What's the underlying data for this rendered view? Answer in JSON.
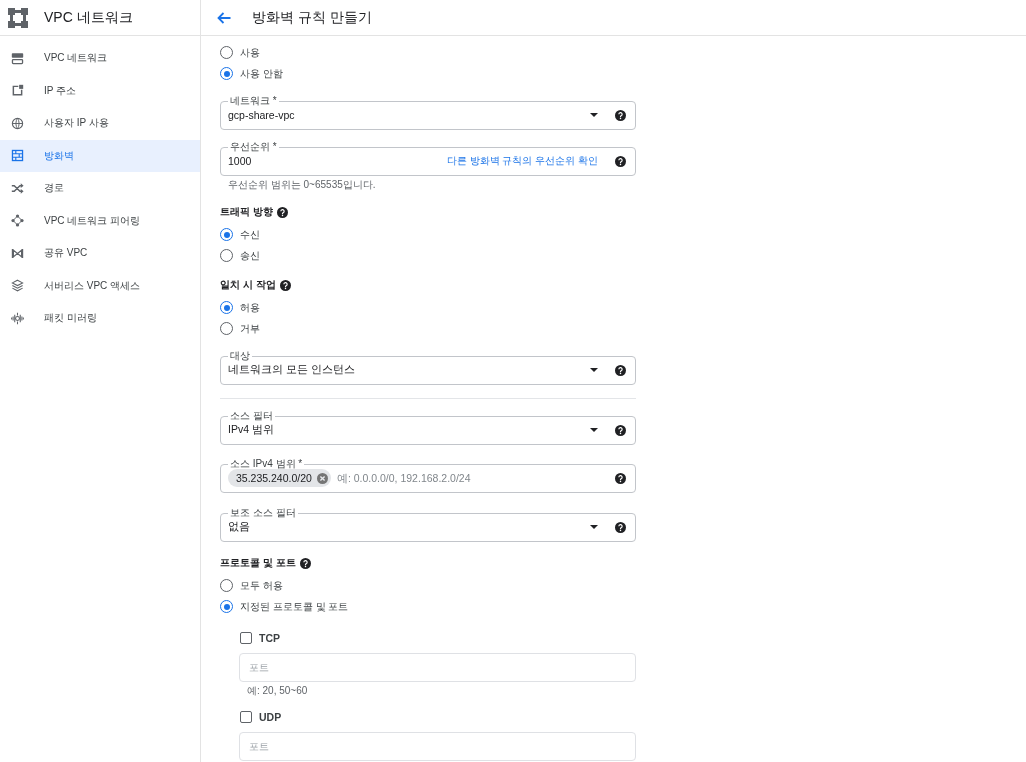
{
  "sidebar": {
    "title": "VPC 네트워크",
    "items": [
      {
        "label": "VPC 네트워크",
        "selected": false
      },
      {
        "label": "IP 주소",
        "selected": false
      },
      {
        "label": "사용자 IP 사용",
        "selected": false
      },
      {
        "label": "방화벽",
        "selected": true
      },
      {
        "label": "경로",
        "selected": false
      },
      {
        "label": "VPC 네트워크 피어링",
        "selected": false
      },
      {
        "label": "공유 VPC",
        "selected": false
      },
      {
        "label": "서버리스 VPC 액세스",
        "selected": false
      },
      {
        "label": "패킷 미러링",
        "selected": false
      }
    ]
  },
  "header": {
    "title": "방화벽 규칙 만들기"
  },
  "form": [
    {
      "kind": "radios",
      "options": [
        {
          "label": "사용",
          "selected": false
        },
        {
          "label": "사용 안함",
          "selected": true
        }
      ]
    },
    {
      "kind": "select",
      "label": "네트워크 *",
      "value": "gcp-share-vpc"
    },
    {
      "kind": "input",
      "label": "우선순위 *",
      "value": "1000",
      "link": "다른 방화벽 규칙의 우선순위 확인",
      "hint": "우선순위 범위는 0~65535입니다."
    },
    {
      "kind": "heading",
      "text": "트래픽 방향"
    },
    {
      "kind": "radios",
      "options": [
        {
          "label": "수신",
          "selected": true
        },
        {
          "label": "송신",
          "selected": false
        }
      ]
    },
    {
      "kind": "heading",
      "text": "일치 시 작업"
    },
    {
      "kind": "radios",
      "options": [
        {
          "label": "허용",
          "selected": true
        },
        {
          "label": "거부",
          "selected": false
        }
      ]
    },
    {
      "kind": "select",
      "label": "대상",
      "value": "네트워크의 모든 인스턴스"
    },
    {
      "kind": "divider"
    },
    {
      "kind": "select",
      "label": "소스 필터",
      "value": "IPv4 범위"
    },
    {
      "kind": "chips",
      "label": "소스 IPv4 범위 *",
      "chips": [
        "35.235.240.0/20"
      ],
      "placeholder": "예: 0.0.0.0/0, 192.168.2.0/24"
    },
    {
      "kind": "select",
      "label": "보조 소스 필터",
      "value": "없음"
    },
    {
      "kind": "heading",
      "text": "프로토콜 및 포트"
    },
    {
      "kind": "radios",
      "options": [
        {
          "label": "모두 허용",
          "selected": false
        },
        {
          "label": "지정된 프로토콜 및 포트",
          "selected": true
        }
      ]
    },
    {
      "kind": "protocols",
      "items": [
        {
          "label": "TCP",
          "checked": false,
          "placeholder": "포트",
          "hint": "예: 20, 50~60"
        },
        {
          "label": "UDP",
          "checked": false,
          "placeholder": "포트"
        }
      ]
    }
  ]
}
